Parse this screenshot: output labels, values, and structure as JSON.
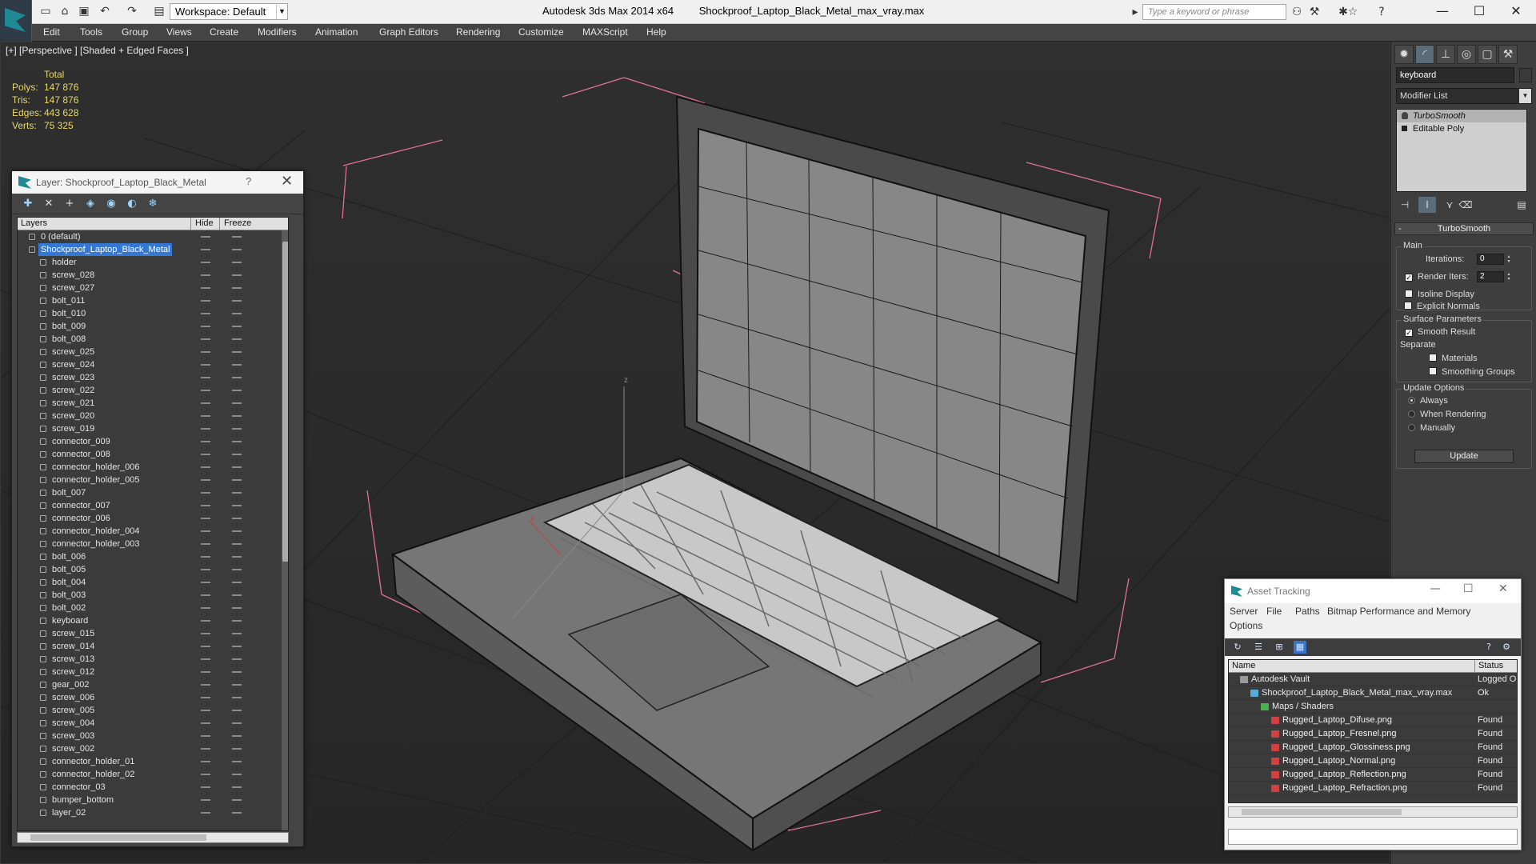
{
  "titlebar": {
    "workspace": "Workspace: Default",
    "app_name": "Autodesk 3ds Max  2014 x64",
    "file_name": "Shockproof_Laptop_Black_Metal_max_vray.max",
    "search_placeholder": "Type a keyword or phrase",
    "min_glyph": "—",
    "max_glyph": "☐",
    "close_glyph": "✕"
  },
  "menu": [
    "Edit",
    "Tools",
    "Group",
    "Views",
    "Create",
    "Modifiers",
    "Animation",
    "Graph Editors",
    "Rendering",
    "Customize",
    "MAXScript",
    "Help"
  ],
  "viewport": {
    "label": "[+] [Perspective ] [Shaded + Edged Faces ]",
    "stats_header": "Total",
    "stats": [
      {
        "k": "Polys:",
        "v": "147 876"
      },
      {
        "k": "Tris:",
        "v": "147 876"
      },
      {
        "k": "Edges:",
        "v": "443 628"
      },
      {
        "k": "Verts:",
        "v": "75 325"
      }
    ],
    "axis_z": "z",
    "axis_x": "x"
  },
  "command_panel": {
    "object_name": "keyboard",
    "modifier_list": "Modifier List",
    "stack": [
      "TurboSmooth",
      "Editable Poly"
    ],
    "rollout_title": "TurboSmooth",
    "main_group": "Main",
    "iterations_label": "Iterations:",
    "iterations_value": "0",
    "render_iters_label": "Render Iters:",
    "render_iters_value": "2",
    "isoline_label": "Isoline Display",
    "explicit_normals_label": "Explicit Normals",
    "surface_group": "Surface Parameters",
    "smooth_result_label": "Smooth Result",
    "separate_label": "Separate",
    "materials_label": "Materials",
    "smoothing_groups_label": "Smoothing Groups",
    "update_group": "Update Options",
    "update_options": [
      "Always",
      "When Rendering",
      "Manually"
    ],
    "update_button": "Update"
  },
  "layer_window": {
    "title": "Layer: Shockproof_Laptop_Black_Metal",
    "help": "?",
    "close": "✕",
    "col_layers": "Layers",
    "col_hide": "Hide",
    "col_freeze": "Freeze",
    "rows": [
      {
        "name": "0 (default)",
        "level": 0
      },
      {
        "name": "Shockproof_Laptop_Black_Metal",
        "level": 0,
        "selected": true
      },
      {
        "name": "holder",
        "level": 1
      },
      {
        "name": "screw_028",
        "level": 1
      },
      {
        "name": "screw_027",
        "level": 1
      },
      {
        "name": "bolt_011",
        "level": 1
      },
      {
        "name": "bolt_010",
        "level": 1
      },
      {
        "name": "bolt_009",
        "level": 1
      },
      {
        "name": "bolt_008",
        "level": 1
      },
      {
        "name": "screw_025",
        "level": 1
      },
      {
        "name": "screw_024",
        "level": 1
      },
      {
        "name": "screw_023",
        "level": 1
      },
      {
        "name": "screw_022",
        "level": 1
      },
      {
        "name": "screw_021",
        "level": 1
      },
      {
        "name": "screw_020",
        "level": 1
      },
      {
        "name": "screw_019",
        "level": 1
      },
      {
        "name": "connector_009",
        "level": 1
      },
      {
        "name": "connector_008",
        "level": 1
      },
      {
        "name": "connector_holder_006",
        "level": 1
      },
      {
        "name": "connector_holder_005",
        "level": 1
      },
      {
        "name": "bolt_007",
        "level": 1
      },
      {
        "name": "connector_007",
        "level": 1
      },
      {
        "name": "connector_006",
        "level": 1
      },
      {
        "name": "connector_holder_004",
        "level": 1
      },
      {
        "name": "connector_holder_003",
        "level": 1
      },
      {
        "name": "bolt_006",
        "level": 1
      },
      {
        "name": "bolt_005",
        "level": 1
      },
      {
        "name": "bolt_004",
        "level": 1
      },
      {
        "name": "bolt_003",
        "level": 1
      },
      {
        "name": "bolt_002",
        "level": 1
      },
      {
        "name": "keyboard",
        "level": 1
      },
      {
        "name": "screw_015",
        "level": 1
      },
      {
        "name": "screw_014",
        "level": 1
      },
      {
        "name": "screw_013",
        "level": 1
      },
      {
        "name": "screw_012",
        "level": 1
      },
      {
        "name": "gear_002",
        "level": 1
      },
      {
        "name": "screw_006",
        "level": 1
      },
      {
        "name": "screw_005",
        "level": 1
      },
      {
        "name": "screw_004",
        "level": 1
      },
      {
        "name": "screw_003",
        "level": 1
      },
      {
        "name": "screw_002",
        "level": 1
      },
      {
        "name": "connector_holder_01",
        "level": 1
      },
      {
        "name": "connector_holder_02",
        "level": 1
      },
      {
        "name": "connector_03",
        "level": 1
      },
      {
        "name": "bumper_bottom",
        "level": 1
      },
      {
        "name": "layer_02",
        "level": 1
      }
    ]
  },
  "asset_window": {
    "title": "Asset Tracking",
    "menu": [
      "Server",
      "File",
      "Paths",
      "Bitmap Performance and Memory",
      "Options"
    ],
    "col_name": "Name",
    "col_status": "Status",
    "rows": [
      {
        "name": "Autodesk Vault",
        "status": "Logged O",
        "level": 0,
        "icon": "vault"
      },
      {
        "name": "Shockproof_Laptop_Black_Metal_max_vray.max",
        "status": "Ok",
        "level": 1,
        "icon": "max"
      },
      {
        "name": "Maps / Shaders",
        "status": "",
        "level": 2,
        "icon": "maps"
      },
      {
        "name": "Rugged_Laptop_Difuse.png",
        "status": "Found",
        "level": 3,
        "icon": "png"
      },
      {
        "name": "Rugged_Laptop_Fresnel.png",
        "status": "Found",
        "level": 3,
        "icon": "png"
      },
      {
        "name": "Rugged_Laptop_Glossiness.png",
        "status": "Found",
        "level": 3,
        "icon": "png"
      },
      {
        "name": "Rugged_Laptop_Normal.png",
        "status": "Found",
        "level": 3,
        "icon": "png"
      },
      {
        "name": "Rugged_Laptop_Reflection.png",
        "status": "Found",
        "level": 3,
        "icon": "png"
      },
      {
        "name": "Rugged_Laptop_Refraction.png",
        "status": "Found",
        "level": 3,
        "icon": "png"
      }
    ]
  },
  "colors": {
    "stats": "#e8d76a",
    "selection": "#3478d4",
    "bbox": "#e0709a",
    "png_icon": "#d04040"
  }
}
